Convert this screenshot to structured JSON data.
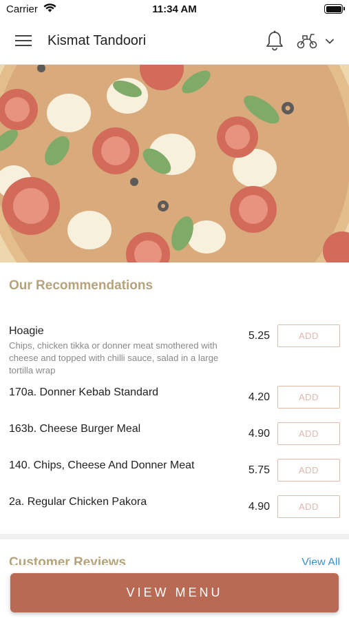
{
  "status_bar": {
    "carrier": "Carrier",
    "time": "11:34 AM",
    "icons": [
      "wifi-icon",
      "battery-icon"
    ]
  },
  "header": {
    "title": "Kismat Tandoori",
    "icons": [
      "hamburger-menu-icon",
      "bell-icon",
      "scooter-icon",
      "chevron-down-icon"
    ]
  },
  "hero": {
    "image": "pizza-hero-image"
  },
  "recommendations": {
    "title": "Our Recommendations",
    "add_label": "ADD",
    "items": [
      {
        "name": "Hoagie",
        "description": "Chips, chicken tikka or donner meat smothered with cheese and topped with chilli sauce, salad in a large tortilla wrap",
        "price": "5.25"
      },
      {
        "name": "170a. Donner Kebab Standard",
        "description": "",
        "price": "4.20"
      },
      {
        "name": "163b. Cheese Burger Meal",
        "description": "",
        "price": "4.90"
      },
      {
        "name": "140. Chips, Cheese And Donner Meat",
        "description": "",
        "price": "5.75"
      },
      {
        "name": "2a. Regular Chicken Pakora",
        "description": "",
        "price": "4.90"
      }
    ]
  },
  "reviews": {
    "title": "Customer Reviews",
    "view_all": "View All"
  },
  "footer": {
    "view_menu": "VIEW MENU"
  },
  "colors": {
    "accent": "#b86a54",
    "section_title": "#b5a37c",
    "add_border": "#e3b9a8",
    "link": "#3a8fc8"
  }
}
